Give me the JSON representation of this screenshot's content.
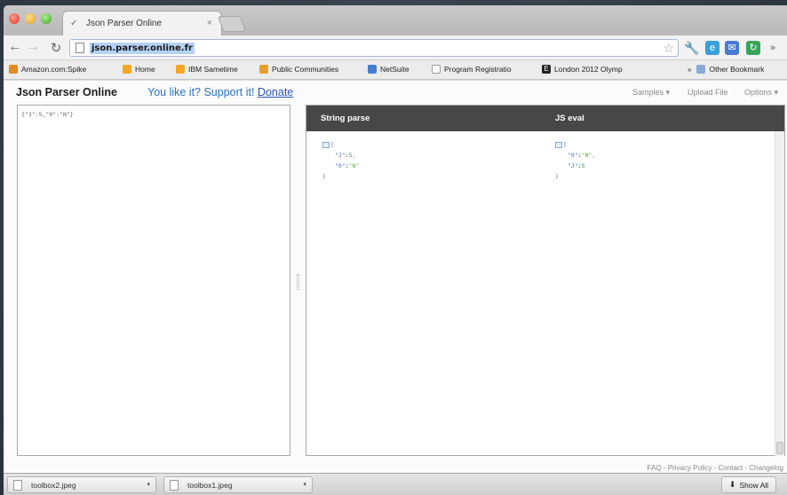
{
  "browser": {
    "tab": {
      "title": "Json Parser Online"
    },
    "address": {
      "url": "json.parser.online.fr"
    },
    "bookmarks": [
      {
        "label": "Amazon.com:Spike",
        "icon_color": "#e38b1e"
      },
      {
        "label": "Home",
        "icon_color": "#f5a623"
      },
      {
        "label": "IBM Sametime",
        "icon_color": "#f5a623"
      },
      {
        "label": "Public Communities",
        "icon_color": "#e8a02c"
      },
      {
        "label": "NetSuite",
        "icon_color": "#4a7bd3"
      },
      {
        "label": "Program Registratio",
        "icon_color": "#ffffff"
      },
      {
        "label": "London 2012 Olymp",
        "icon_color": "#222222"
      },
      {
        "label": "Other Bookmark",
        "icon_color": "#8aa9d6"
      }
    ]
  },
  "app": {
    "title": "Json Parser Online",
    "support_text": "You like it? Support it!",
    "donate_link": "Donate",
    "menu": {
      "samples": "Samples ▾",
      "upload": "Upload File",
      "options": "Options ▾"
    }
  },
  "editor": {
    "input_text": "{\"J\":5,\"0\":\"N\"}"
  },
  "results": {
    "string_parse_label": "String parse",
    "js_eval_label": "JS eval",
    "string_parse": {
      "open": "{",
      "lines": [
        {
          "key": "\"J\"",
          "value": "5",
          "value_type": "num",
          "trail": ","
        },
        {
          "key": "\"0\"",
          "value": "\"N\"",
          "value_type": "str",
          "trail": ""
        }
      ],
      "close": "}"
    },
    "js_eval": {
      "open": "{",
      "lines": [
        {
          "key": "\"0\"",
          "value": "\"N\"",
          "value_type": "str",
          "trail": ","
        },
        {
          "key": "\"J\"",
          "value": "5",
          "value_type": "num",
          "trail": ""
        }
      ],
      "close": "}"
    }
  },
  "footer": {
    "links": "FAQ - Privacy Policy - Contact - Changelog"
  },
  "downloads": {
    "items": [
      {
        "filename": "toolbox2.jpeg"
      },
      {
        "filename": "toolbox1.jpeg"
      }
    ],
    "show_all": "Show All"
  },
  "colors": {
    "accent_link": "#2a72c6",
    "header_bar": "#474747"
  }
}
